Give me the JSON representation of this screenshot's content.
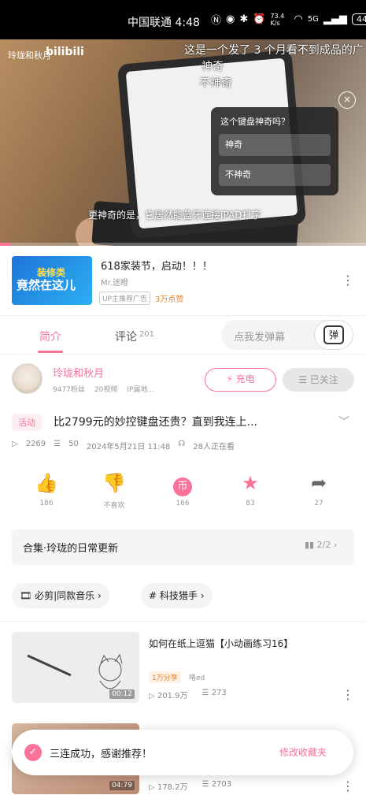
{
  "status_bar": {
    "carrier": "中国联通 4:48",
    "speed": "73.4 K/s",
    "network": "5G",
    "battery": "44"
  },
  "video": {
    "channel": "玲珑和秋月",
    "logo": "bilibili",
    "danmaku": [
      "这是一个发了 3 个月看不到成品的广",
      "神奇",
      "不神奇"
    ],
    "subtitle": "更神奇的是，它居然能蓝牙连接IPAD打字",
    "close_label": "×",
    "poll": {
      "question": "这个键盘神奇吗？",
      "options": [
        "神奇",
        "不神奇"
      ]
    },
    "progress": 0.03
  },
  "ad": {
    "thumb_line1": "装修类",
    "thumb_line2": "竟然在这儿",
    "title": "618家装节，启动！！！",
    "sub": "Mr.迷瞪",
    "tag": "UP主推荐广告",
    "tag2": "3万点赞"
  },
  "tabs": {
    "intro": "简介",
    "comments": "评论",
    "comments_count": "201",
    "danmaku_placeholder": "点我发弹幕",
    "danmaku_button": "弹"
  },
  "uploader": {
    "name": "玲珑和秋月",
    "fans": "9477粉丝",
    "videos": "20视频",
    "ip": "IP属地...",
    "charge": "充电",
    "follow": "已关注"
  },
  "title": {
    "tag": "活动",
    "text": "比2799元的妙控键盘还贵？直到我连上..."
  },
  "stats": {
    "views": "2269",
    "danmaku": "50",
    "date": "2024年5月21日 11:48",
    "watching": "28人正在看"
  },
  "actions": [
    {
      "label": "186"
    },
    {
      "label": "不喜欢"
    },
    {
      "label": "166"
    },
    {
      "label": "83"
    },
    {
      "label": "27"
    }
  ],
  "collection": {
    "label": "合集·玲珑的日常更新",
    "progress": "2/2"
  },
  "chips": [
    "必剪|同款音乐",
    "科技猎手"
  ],
  "recs": [
    {
      "title": "如何在纸上逗猫【小动画练习16】",
      "duration": "00:12",
      "badge": "1万分享",
      "author": "咯ed",
      "views": "201.9万",
      "danmaku": "273"
    },
    {
      "title": "",
      "duration": "04:79",
      "badge": "",
      "author": "",
      "views": "178.2万",
      "danmaku": "2703"
    }
  ],
  "toast": {
    "message": "三连成功，感谢推荐！",
    "link": "修改收藏夹"
  }
}
